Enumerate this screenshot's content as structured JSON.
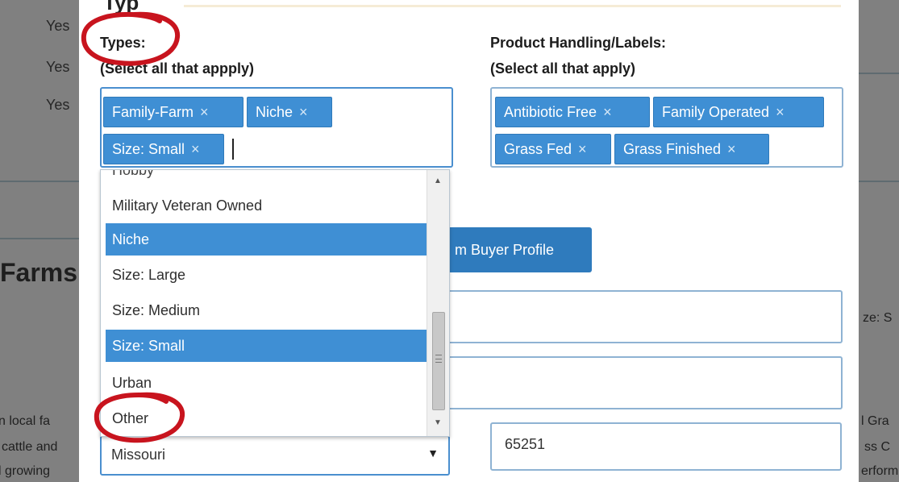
{
  "background": {
    "yes_values": [
      "Yes",
      "Yes",
      "Yes"
    ],
    "section_heading": "Farms",
    "left_snippets": [
      "n local fa",
      "cattle and",
      "l growing"
    ],
    "right_snippets": [
      "ze: S",
      "l Gra",
      "ss C",
      "erform"
    ]
  },
  "modal": {
    "top_title": "Typ",
    "types": {
      "label": "Types:",
      "sublabel": "(Select all that appply)",
      "selected_tags": [
        "Family-Farm",
        "Niche",
        "Size: Small"
      ],
      "dropdown_partial": "Hobby",
      "options": [
        {
          "label": "Military Veteran Owned",
          "selected": false
        },
        {
          "label": "Niche",
          "selected": true
        },
        {
          "label": "Size: Large",
          "selected": false
        },
        {
          "label": "Size: Medium",
          "selected": false
        },
        {
          "label": "Size: Small",
          "selected": true
        },
        {
          "label": "Urban",
          "selected": false
        },
        {
          "label": "Other",
          "selected": false
        }
      ]
    },
    "handling": {
      "label": "Product Handling/Labels:",
      "sublabel": "(Select all that apply)",
      "selected_tags": [
        "Antibiotic Free",
        "Family Operated",
        "Grass Fed",
        "Grass Finished"
      ]
    },
    "submit_button_label": "m Buyer Profile",
    "state_select_value": "Missouri",
    "zip_value": "65251",
    "tag_remove_glyph": "×",
    "annotation_color": "#c8141e",
    "accent_color": "#3f8fd4"
  }
}
